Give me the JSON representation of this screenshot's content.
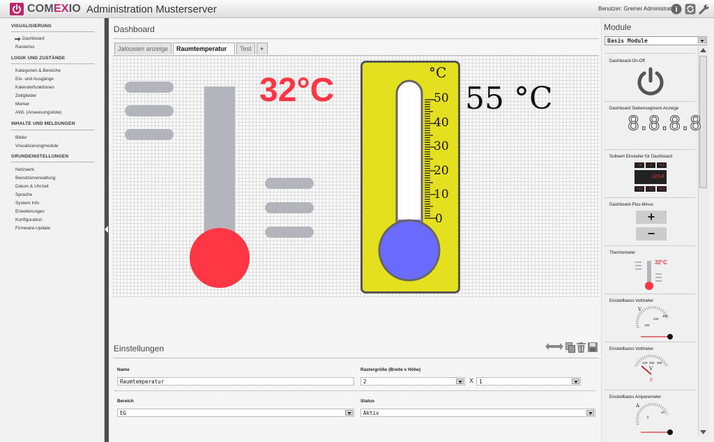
{
  "header": {
    "brand_prefix": "COM",
    "brand_accent": "EX",
    "brand_suffix": "IO",
    "app_title": "Administration Musterserver",
    "user_label": "Benutzer: Greiner Administrator",
    "icons": [
      "help-icon",
      "refresh-icon",
      "wrench-icon"
    ]
  },
  "sidebar": {
    "sections": [
      {
        "title": "VISUALISIERUNG",
        "items": [
          "Dashboard",
          "Rasterlos"
        ]
      },
      {
        "title": "LOGIK UND ZUSTÄNDE",
        "items": [
          "Kategorien & Bereiche",
          "Ein- und Ausgänge",
          "Kalenderfunktionen",
          "Zeitglieder",
          "Merker",
          "AWL (Anweisungsliste)"
        ]
      },
      {
        "title": "INHALTE UND MELDUNGEN",
        "items": [
          "Bilder",
          "Visualisierungmodule"
        ]
      },
      {
        "title": "GRUNDEINSTELLUNGEN",
        "items": [
          "Netzwerk",
          "Benutzerverwaltung",
          "Datum & Uhrzeit",
          "Sprache",
          "System Info",
          "Erweiterungen",
          "Konfiguration",
          "Firmware-Update"
        ]
      }
    ],
    "active_item": "Dashboard"
  },
  "main": {
    "title": "Dashboard",
    "tabs": [
      "Jalousien anzeige",
      "Raumtemperatur",
      "Test",
      "+"
    ],
    "active_tab": "Raumtemperatur",
    "widgets": {
      "thermometer_value": "32°C",
      "gauge_unit": "°C",
      "gauge_value": "55 °C",
      "gauge_scale": [
        "50",
        "40",
        "30",
        "20",
        "10",
        "0"
      ]
    },
    "settings": {
      "title": "Einstellungen",
      "name_label": "Name",
      "name_value": "Raumtemperatur",
      "raster_label": "Rastergröße (Breite x Höhe)",
      "raster_width": "2",
      "raster_x": "X",
      "raster_height": "1",
      "bereich_label": "Bereich",
      "bereich_value": "EG",
      "status_label": "Status",
      "status_value": "Aktiv"
    }
  },
  "modules": {
    "title": "Module",
    "selected": "Basis Module",
    "items": [
      {
        "label": "Dashboard-On-Off"
      },
      {
        "label": "Dashboard Siebensegment-Anzeige",
        "display": "8.8.8.8"
      },
      {
        "label": "Sollwert Einsteller für Dashboard",
        "display": "123,4",
        "buttons_top": [
          "-10",
          "-1",
          "-0.1"
        ],
        "buttons_bottom": [
          "+10",
          "+1",
          "+0.1"
        ]
      },
      {
        "label": "Dashboard-Plus-Minus",
        "plus": "+",
        "minus": "−"
      },
      {
        "label": "Thermometer",
        "value": "32°C"
      },
      {
        "label": "Einstellbares Voltmeter",
        "unit": "V",
        "ticks": [
          "100",
          "200",
          "300"
        ]
      },
      {
        "label": "Einstellbares Voltmeter",
        "unit": "V",
        "ticks": [
          "100",
          "200",
          "300"
        ],
        "value": "0"
      },
      {
        "label": "Einstellbares Amperemeter",
        "unit": "A",
        "ticks": [
          "5",
          "10"
        ]
      }
    ]
  },
  "colors": {
    "brand": "#c4226f",
    "red": "#ff3644",
    "blue": "#6b6bff",
    "yellow": "#e4e020",
    "gray_bar": "#b4b4bc"
  }
}
